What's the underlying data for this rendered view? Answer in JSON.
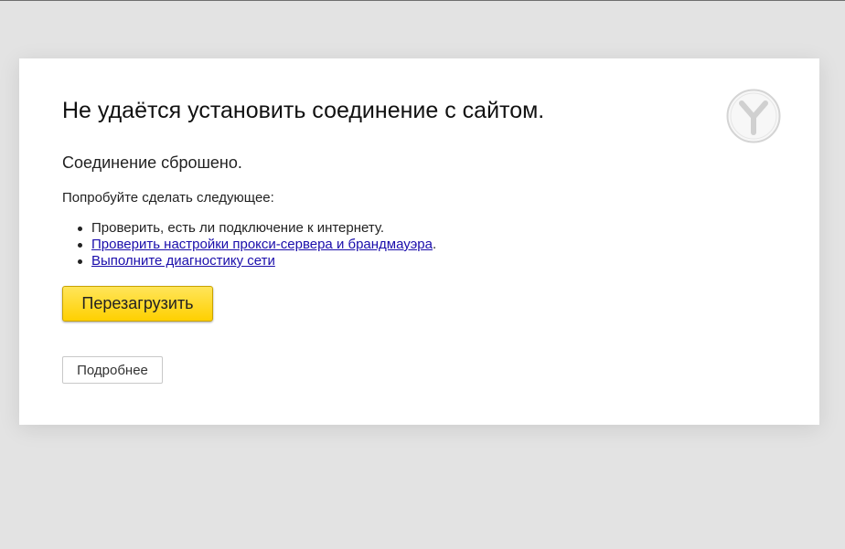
{
  "error": {
    "title": "Не удаётся установить соединение с сайтом.",
    "subtitle": "Соединение сброшено.",
    "try_text": "Попробуйте сделать следующее:",
    "suggestions": [
      {
        "text": "Проверить, есть ли подключение к интернету.",
        "link": false
      },
      {
        "text": "Проверить настройки прокси-сервера и брандмауэра",
        "trail": ".",
        "link": true
      },
      {
        "text": "Выполните диагностику сети",
        "trail": "",
        "link": true
      }
    ],
    "reload_label": "Перезагрузить",
    "details_label": "Подробнее"
  },
  "logo": {
    "icon": "yandex-browser-logo-icon"
  },
  "colors": {
    "background": "#e3e3e3",
    "card": "#ffffff",
    "button_yellow": "#ffd000",
    "link": "#1a0dab"
  }
}
